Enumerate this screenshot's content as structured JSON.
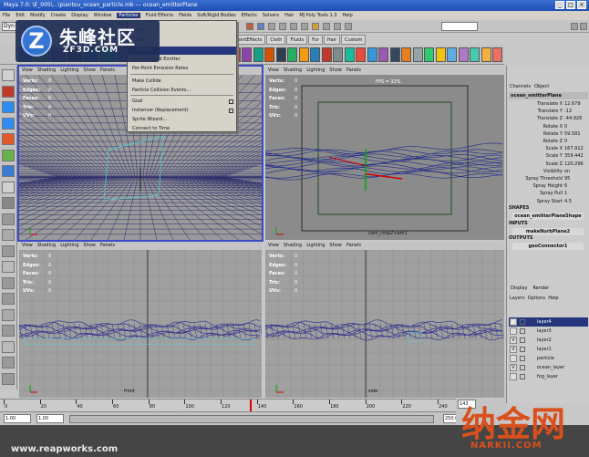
{
  "window": {
    "title": "Maya 7.0: \\E_005\\...\\piantou_ocean_particle.mb  ---  ocean_emitterPlane"
  },
  "menubar": {
    "items": [
      "File",
      "Edit",
      "Modify",
      "Create",
      "Display",
      "Window",
      "Particles",
      "Fluid Effects",
      "Fields",
      "Soft/Rigid Bodies",
      "Effects",
      "Solvers",
      "Hair",
      "MJ Poly Tools 1.3",
      "Help"
    ],
    "active_index": 6
  },
  "status_line": {
    "menu_set": "Dyn"
  },
  "shelf": {
    "tabs": [
      "PaintEffects",
      "Cloth",
      "Fluids",
      "Fur",
      "Hair",
      "Custom"
    ]
  },
  "dropdown_menu": {
    "items": [
      {
        "label": "...tool"
      },
      {
        "label": "...tter"
      },
      {
        "label": "...Object",
        "selected": true
      },
      {
        "label": "Use Selected Emitter"
      },
      {
        "label": "Per-Point Emission Rates"
      },
      {
        "label": "Make Collide"
      },
      {
        "label": "Particle Collision Events..."
      },
      {
        "label": "Goal"
      },
      {
        "label": "Instancer (Replacement)"
      },
      {
        "label": "Sprite Wizard..."
      },
      {
        "label": "Connect to Time"
      }
    ]
  },
  "panel_menu": [
    "View",
    "Shading",
    "Lighting",
    "Show",
    "Panels"
  ],
  "hud": {
    "labels": [
      "Verts:",
      "Edges:",
      "Faces:",
      "Tris:",
      "UVs:"
    ],
    "values": [
      "0",
      "0",
      "0",
      "0",
      "0"
    ]
  },
  "viewports": [
    {
      "label": "",
      "active": true
    },
    {
      "label": "cam_cmp2:cam1",
      "fps": "FPS = 32%"
    },
    {
      "label": "front"
    },
    {
      "label": "side"
    }
  ],
  "channel_box": {
    "header": [
      "Channels",
      "Object"
    ],
    "object_name": "ocean_emitterPlane",
    "attributes": [
      {
        "name": "Translate X",
        "value": "12.679"
      },
      {
        "name": "Translate Y",
        "value": "-12"
      },
      {
        "name": "Translate Z",
        "value": "-44.926"
      },
      {
        "name": "Rotate X",
        "value": "0"
      },
      {
        "name": "Rotate Y",
        "value": "59.581"
      },
      {
        "name": "Rotate Z",
        "value": "0"
      },
      {
        "name": "Scale X",
        "value": "167.912"
      },
      {
        "name": "Scale Y",
        "value": "359.442"
      },
      {
        "name": "Scale Z",
        "value": "120.296"
      },
      {
        "name": "Visibility",
        "value": "on"
      },
      {
        "name": "Spray Threshold",
        "value": "95"
      },
      {
        "name": "Spray Height",
        "value": "6"
      },
      {
        "name": "Spray Pull",
        "value": "1"
      },
      {
        "name": "Spray Start",
        "value": "4.5"
      }
    ],
    "shapes_title": "SHAPES",
    "shape_name": "ocean_emitterPlaneShape",
    "inputs_title": "INPUTS",
    "input_name": "makeNurbPlane2",
    "outputs_title": "OUTPUTS",
    "output_name": "geoConnector1"
  },
  "layer_editor": {
    "display_label": "Display",
    "render_label": "Render",
    "menu": "Layers  Options  Help",
    "layers": [
      {
        "name": "layer4",
        "visible": "V",
        "selected": true
      },
      {
        "name": "layer3",
        "visible": ""
      },
      {
        "name": "layer2",
        "visible": "V"
      },
      {
        "name": "layer1",
        "visible": "V"
      },
      {
        "name": "particle",
        "visible": ""
      },
      {
        "name": "ocean_layer",
        "visible": "V"
      },
      {
        "name": "fog_layer",
        "visible": ""
      }
    ]
  },
  "time_slider": {
    "ticks": [
      "0",
      "20",
      "40",
      "60",
      "80",
      "100",
      "120",
      "140",
      "160",
      "180",
      "200",
      "220",
      "240"
    ]
  },
  "range_slider": {
    "start": "1.00",
    "start2": "1.00",
    "end": "250.00"
  },
  "current_frame": "143",
  "watermarks": {
    "logo_cn": "朱峰社区",
    "logo_en": "ZF3D.COM",
    "footer_url": "www.reapworks.com",
    "corner_cn": "纳金网",
    "corner_en": "NARKII.COM"
  },
  "colors": {
    "title_bar": "#1f4fb2",
    "menu_highlight": "#25367c",
    "viewport_gray": "#a0a0a0",
    "wireframe": "#2a2a8c",
    "persp_bg": "#8b8b8b"
  }
}
